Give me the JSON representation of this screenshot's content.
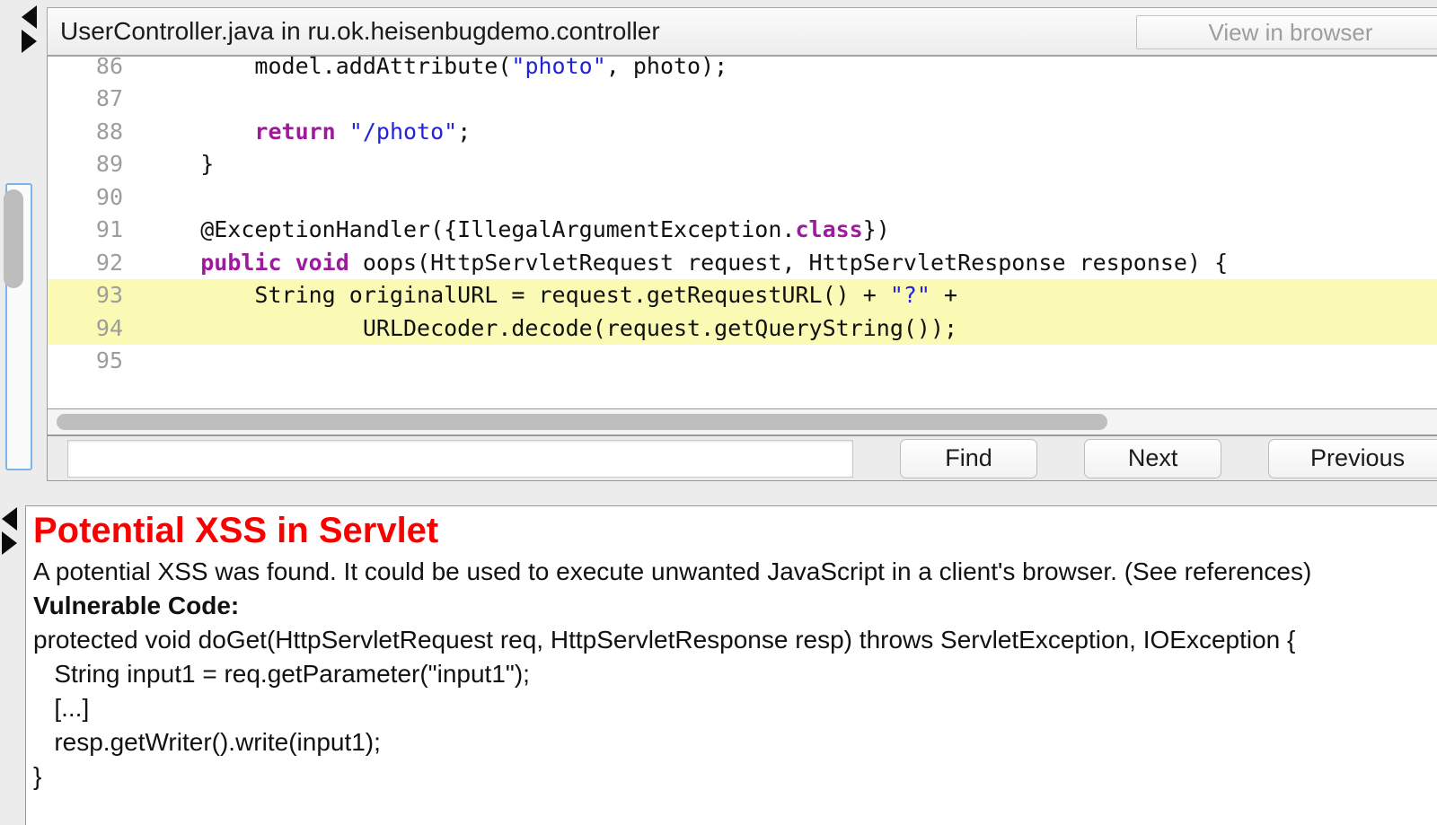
{
  "source_panel": {
    "title": "UserController.java in ru.ok.heisenbugdemo.controller",
    "view_in_browser_label": "View in browser",
    "code_lines": [
      {
        "no": "86",
        "clipped": true,
        "segments": [
          {
            "t": "        model.addAttribute(",
            "k": "plain"
          },
          {
            "t": "\"photo\"",
            "k": "str"
          },
          {
            "t": ", photo);",
            "k": "plain"
          }
        ]
      },
      {
        "no": "87",
        "segments": [
          {
            "t": "",
            "k": "plain"
          }
        ]
      },
      {
        "no": "88",
        "segments": [
          {
            "t": "        ",
            "k": "plain"
          },
          {
            "t": "return",
            "k": "kw"
          },
          {
            "t": " ",
            "k": "plain"
          },
          {
            "t": "\"/photo\"",
            "k": "str"
          },
          {
            "t": ";",
            "k": "plain"
          }
        ]
      },
      {
        "no": "89",
        "segments": [
          {
            "t": "    }",
            "k": "plain"
          }
        ]
      },
      {
        "no": "90",
        "segments": [
          {
            "t": "",
            "k": "plain"
          }
        ]
      },
      {
        "no": "91",
        "segments": [
          {
            "t": "    @ExceptionHandler({IllegalArgumentException.",
            "k": "plain"
          },
          {
            "t": "class",
            "k": "cls"
          },
          {
            "t": "})",
            "k": "plain"
          }
        ]
      },
      {
        "no": "92",
        "segments": [
          {
            "t": "    ",
            "k": "plain"
          },
          {
            "t": "public void",
            "k": "kw"
          },
          {
            "t": " oops(HttpServletRequest request, HttpServletResponse response) {",
            "k": "plain"
          }
        ]
      },
      {
        "no": "93",
        "highlight": true,
        "segments": [
          {
            "t": "        String originalURL = request.getRequestURL() + ",
            "k": "plain"
          },
          {
            "t": "\"?\"",
            "k": "str"
          },
          {
            "t": " +",
            "k": "plain"
          }
        ]
      },
      {
        "no": "94",
        "highlight": true,
        "segments": [
          {
            "t": "                URLDecoder.decode(request.getQueryString());",
            "k": "plain"
          }
        ]
      },
      {
        "no": "95",
        "segments": [
          {
            "t": "",
            "k": "plain"
          }
        ]
      }
    ],
    "find_bar": {
      "query": "",
      "placeholder": "",
      "find_label": "Find",
      "next_label": "Next",
      "previous_label": "Previous"
    }
  },
  "description_panel": {
    "title": "Potential XSS in Servlet",
    "paragraph": "A potential XSS was found. It could be used to execute unwanted JavaScript in a client's browser. (See references)",
    "vulnerable_code_label": "Vulnerable Code:",
    "vulnerable_code": [
      "protected void doGet(HttpServletRequest req, HttpServletResponse resp) throws ServletException, IOException {",
      "   String input1 = req.getParameter(\"input1\");",
      "   [...]",
      "   resp.getWriter().write(input1);",
      "}"
    ]
  },
  "colors": {
    "alert_red": "#fb0000",
    "highlight_yellow": "#fafab4",
    "keyword_purple": "#9c1a9c",
    "string_blue": "#2222dd",
    "line_number_gray": "#9d9d9d",
    "panel_gray": "#ececec",
    "focus_blue": "#7eb4e8"
  }
}
